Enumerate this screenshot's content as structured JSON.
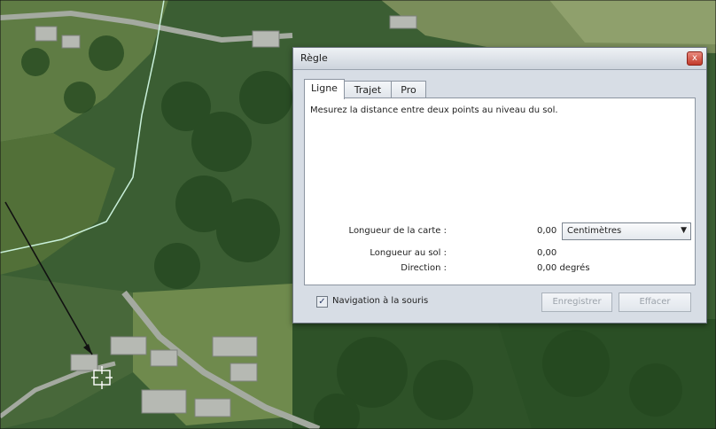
{
  "dialog": {
    "title": "Règle",
    "close_label": "x",
    "tabs": [
      {
        "label": "Ligne",
        "active": true
      },
      {
        "label": "Trajet",
        "active": false
      },
      {
        "label": "Pro",
        "active": false
      }
    ],
    "description": "Mesurez la distance entre deux points au niveau du sol.",
    "map_length": {
      "label": "Longueur de la carte :",
      "value": "0,00",
      "unit": "Centimètres"
    },
    "ground_length": {
      "label": "Longueur au sol :",
      "value": "0,00"
    },
    "direction": {
      "label": "Direction :",
      "value": "0,00 degrés"
    },
    "mouse_nav": {
      "label": "Navigation à la souris",
      "checked": true
    },
    "save_label": "Enregistrer",
    "clear_label": "Effacer"
  },
  "colors": {
    "forest": "#2f5a2a",
    "field": "#6d8a4c",
    "road": "#9aa39a",
    "path_line": "#bfe8d0"
  }
}
